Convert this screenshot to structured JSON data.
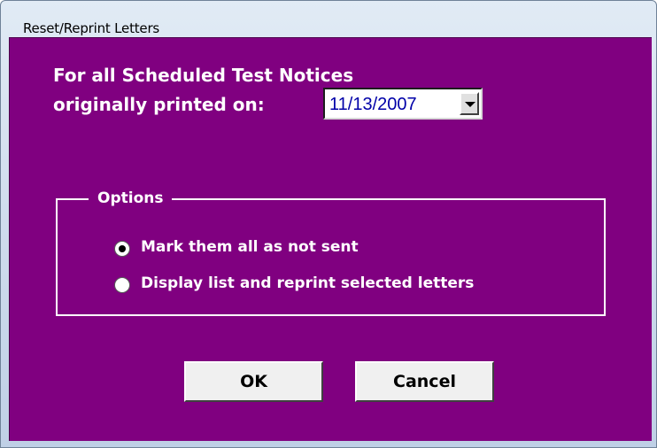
{
  "window": {
    "title": "Reset/Reprint Letters"
  },
  "main": {
    "heading_line1": "For all Scheduled Test Notices",
    "heading_line2": "originally printed on:",
    "date_value": "11/13/2007"
  },
  "options": {
    "legend": "Options",
    "items": [
      {
        "label": "Mark them all as not sent",
        "selected": true
      },
      {
        "label": "Display list and reprint selected letters",
        "selected": false
      }
    ]
  },
  "buttons": {
    "ok": "OK",
    "cancel": "Cancel"
  },
  "colors": {
    "background": "#800080",
    "text": "#ffffff",
    "date_text": "#0000a8"
  }
}
